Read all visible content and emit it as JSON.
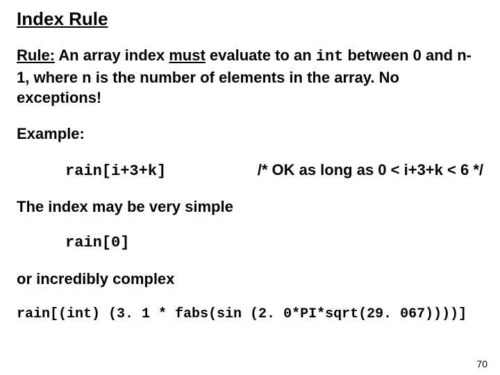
{
  "title": "Index Rule",
  "rule": {
    "label": "Rule:",
    "pre": " An array index ",
    "must": "must",
    "mid": " evaluate to an ",
    "int": "int",
    "post": " between 0 and n-1, where n is the number of elements in the array. No exceptions!"
  },
  "example_label": "Example:",
  "example1": {
    "code": "rain[i+3+k]",
    "comment": "/* OK as long as 0 < i+3+k < 6 */"
  },
  "simple_text": "The index may be very simple",
  "example2": "rain[0]",
  "complex_text": "or incredibly complex",
  "example3": "rain[(int) (3. 1 * fabs(sin (2. 0*PI*sqrt(29. 067))))]",
  "page_number": "70"
}
